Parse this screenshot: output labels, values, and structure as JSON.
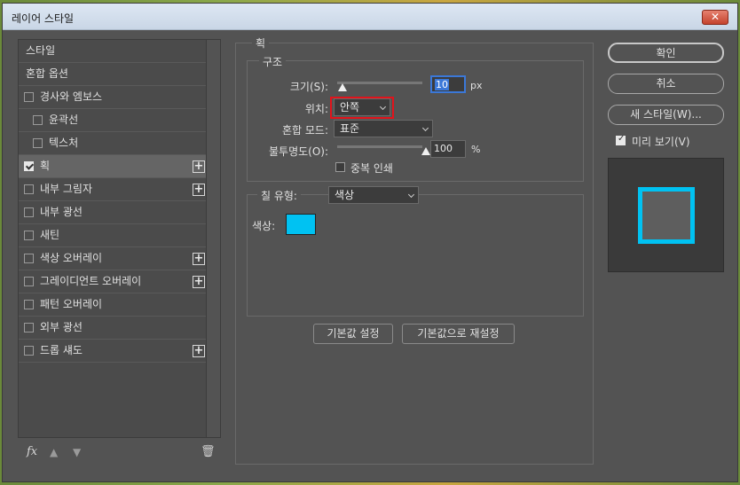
{
  "window": {
    "title": "레이어 스타일",
    "close_label": "✕"
  },
  "styles_list": [
    {
      "label": "스타일",
      "checkbox": false,
      "checked": false,
      "indent": false,
      "plus": false,
      "selected": false
    },
    {
      "label": "혼합 옵션",
      "checkbox": false,
      "checked": false,
      "indent": false,
      "plus": false,
      "selected": false
    },
    {
      "label": "경사와 엠보스",
      "checkbox": true,
      "checked": false,
      "indent": false,
      "plus": false,
      "selected": false
    },
    {
      "label": "윤곽선",
      "checkbox": true,
      "checked": false,
      "indent": true,
      "plus": false,
      "selected": false
    },
    {
      "label": "텍스처",
      "checkbox": true,
      "checked": false,
      "indent": true,
      "plus": false,
      "selected": false
    },
    {
      "label": "획",
      "checkbox": true,
      "checked": true,
      "indent": false,
      "plus": true,
      "selected": true
    },
    {
      "label": "내부 그림자",
      "checkbox": true,
      "checked": false,
      "indent": false,
      "plus": true,
      "selected": false
    },
    {
      "label": "내부 광선",
      "checkbox": true,
      "checked": false,
      "indent": false,
      "plus": false,
      "selected": false
    },
    {
      "label": "새틴",
      "checkbox": true,
      "checked": false,
      "indent": false,
      "plus": false,
      "selected": false
    },
    {
      "label": "색상 오버레이",
      "checkbox": true,
      "checked": false,
      "indent": false,
      "plus": true,
      "selected": false
    },
    {
      "label": "그레이디언트 오버레이",
      "checkbox": true,
      "checked": false,
      "indent": false,
      "plus": true,
      "selected": false
    },
    {
      "label": "패턴 오버레이",
      "checkbox": true,
      "checked": false,
      "indent": false,
      "plus": false,
      "selected": false
    },
    {
      "label": "외부 광선",
      "checkbox": true,
      "checked": false,
      "indent": false,
      "plus": false,
      "selected": false
    },
    {
      "label": "드롭 섀도",
      "checkbox": true,
      "checked": false,
      "indent": false,
      "plus": true,
      "selected": false
    }
  ],
  "footer": {
    "fx": "fx",
    "up_icon": "▲",
    "down_icon": "▼",
    "trash_icon": "🗑"
  },
  "stroke": {
    "section_title": "획",
    "structure_title": "구조",
    "size_label": "크기(S):",
    "size_value": "10",
    "size_unit": "px",
    "size_slider": 0.02,
    "position_label": "위치:",
    "position_value": "안쪽",
    "blend_label": "혼합 모드:",
    "blend_value": "표준",
    "opacity_label": "불투명도(O):",
    "opacity_value": "100",
    "opacity_unit": "%",
    "opacity_slider": 1.0,
    "overprint_label": "중복 인쇄",
    "fill_type_label": "칠 유형:",
    "fill_type_value": "색상",
    "color_label": "색상:",
    "color_value": "#00c2f2",
    "default_button": "기본값 설정",
    "reset_button": "기본값으로 재설정"
  },
  "side_buttons": {
    "ok": "확인",
    "cancel": "취소",
    "new_style": "새 스타일(W)...",
    "preview_label": "미리 보기(V)",
    "preview_checked": true
  },
  "colors": {
    "stroke_color": "#00c2f2",
    "highlight": "#e2131b"
  }
}
